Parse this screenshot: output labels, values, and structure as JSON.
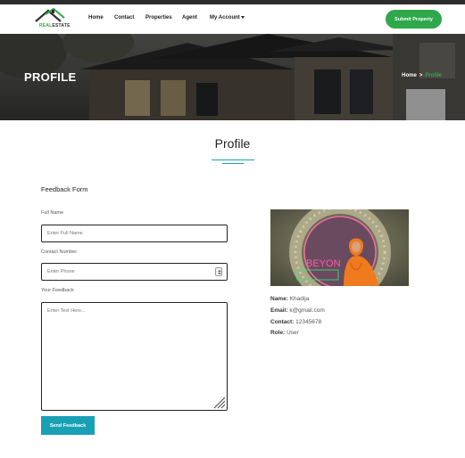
{
  "brand": {
    "logo_real": "REAL",
    "logo_estate": "ESTATE"
  },
  "nav": {
    "home": "Home",
    "contact": "Contact",
    "properties": "Properties",
    "agent": "Agent",
    "account": "My Account",
    "submit": "Submit Property"
  },
  "hero": {
    "title": "PROFILE",
    "breadcrumb": {
      "home": "Home",
      "separator": ">",
      "current": "Profile"
    }
  },
  "section": {
    "title": "Profile"
  },
  "form": {
    "heading": "Feedback Form",
    "full_name": {
      "label": "Full Name",
      "placeholder": "Enter Full Name"
    },
    "contact": {
      "label": "Contact Number",
      "placeholder": "Enter Phone"
    },
    "feedback": {
      "label": "Your Feedback",
      "placeholder": "Enter Text Here..."
    },
    "send": "Send Feedback"
  },
  "profile": {
    "photo_sign": "BEYON",
    "name_label": "Name:",
    "name": "Khadija",
    "email_label": "Email:",
    "email": "k@gmail.com",
    "contact_label": "Contact:",
    "contact": "12345678",
    "role_label": "Role:",
    "role": "User"
  },
  "colors": {
    "accent_green": "#2ea84b",
    "accent_teal": "#1aa0b4",
    "dark": "#2d2d2d"
  },
  "icons": {
    "logo": "house-roof-icon",
    "caret": "caret-down-icon",
    "spinner": "number-spinner-icon",
    "resize": "resize-grip-icon"
  }
}
